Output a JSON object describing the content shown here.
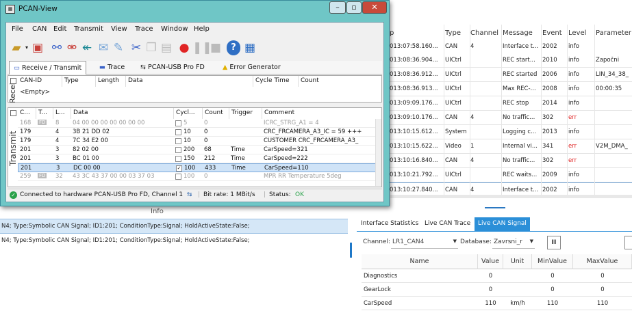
{
  "window": {
    "title": "PCAN-View"
  },
  "menu": [
    "File",
    "CAN",
    "Edit",
    "Transmit",
    "View",
    "Trace",
    "Window",
    "Help"
  ],
  "tabs": [
    "Receive / Transmit",
    "Trace",
    "PCAN-USB Pro FD",
    "Error Generator"
  ],
  "receive": {
    "side_label": "Recei",
    "columns": [
      "CAN-ID",
      "Type",
      "Length",
      "Data",
      "Cycle Time",
      "Count"
    ],
    "empty_text": "<Empty>"
  },
  "transmit": {
    "side_label": "Transmit",
    "columns": [
      "C...",
      "T...",
      "L...",
      "Data",
      "Cycl...",
      "Count",
      "Trigger",
      "Comment"
    ],
    "rows": [
      {
        "id": "168",
        "type": "FD",
        "len": "8",
        "data": "04 00 00 00 00 00 00 00",
        "cycle": "5",
        "count": "0",
        "trigger": "",
        "comment": "ICRC_STRG_A1 = 4",
        "checked": false,
        "dim": true
      },
      {
        "id": "179",
        "type": "",
        "len": "4",
        "data": "3B 21 DD 02",
        "cycle": "10",
        "count": "0",
        "trigger": "",
        "comment": "CRC_FRCAMERA_A3_IC = 59 +++",
        "checked": false,
        "dim": false
      },
      {
        "id": "179",
        "type": "",
        "len": "4",
        "data": "7C 34 E2 00",
        "cycle": "10",
        "count": "0",
        "trigger": "",
        "comment": "CUSTOMER CRC_FRCAMERA_A3_",
        "checked": false,
        "dim": false
      },
      {
        "id": "201",
        "type": "",
        "len": "3",
        "data": "82 02 00",
        "cycle": "200",
        "count": "68",
        "trigger": "Time",
        "comment": "CarSpeed=321",
        "checked": false,
        "dim": false
      },
      {
        "id": "201",
        "type": "",
        "len": "3",
        "data": "BC 01 00",
        "cycle": "150",
        "count": "212",
        "trigger": "Time",
        "comment": "CarSpeed=222",
        "checked": false,
        "dim": false
      },
      {
        "id": "201",
        "type": "",
        "len": "3",
        "data": "DC 00 00",
        "cycle": "100",
        "count": "433",
        "trigger": "Time",
        "comment": "CarSpeed=110",
        "checked": true,
        "dim": false
      },
      {
        "id": "259",
        "type": "FD",
        "len": "32",
        "data": "43 3C 43 37 00 00 03 37 03",
        "cycle": "100",
        "count": "0",
        "trigger": "",
        "comment": "MPR RR Temperature 5deg",
        "checked": false,
        "dim": true
      }
    ]
  },
  "statusbar": {
    "connection": "Connected to hardware PCAN-USB Pro FD, Channel 1",
    "bitrate": "Bit rate: 1 MBit/s",
    "status": "Status:",
    "status_value": "OK"
  },
  "log": {
    "columns": [
      "p",
      "Type",
      "Channel",
      "Message",
      "Event",
      "Level",
      "Parameter"
    ],
    "rows": [
      {
        "time": "13:07:58.160...",
        "type": "CAN",
        "channel": "4",
        "message": "Interface t...",
        "event": "2002",
        "level": "info",
        "param": ""
      },
      {
        "time": "13:08:36.904...",
        "type": "UICtrl",
        "channel": "",
        "message": "REC start...",
        "event": "2010",
        "level": "info",
        "param": "Započni"
      },
      {
        "time": "13:08:36.912...",
        "type": "UICtrl",
        "channel": "",
        "message": "REC started",
        "event": "2006",
        "level": "info",
        "param": "LIN_34_38_"
      },
      {
        "time": "13:08:36.913...",
        "type": "UICtrl",
        "channel": "",
        "message": "Max REC-...",
        "event": "2008",
        "level": "info",
        "param": "00:00:35"
      },
      {
        "time": "13:09:09.176...",
        "type": "UICtrl",
        "channel": "",
        "message": "REC stop",
        "event": "2014",
        "level": "info",
        "param": ""
      },
      {
        "time": "13:09:10.176...",
        "type": "CAN",
        "channel": "4",
        "message": "No traffic...",
        "event": "302",
        "level": "err",
        "param": ""
      },
      {
        "time": "13:10:15.612...",
        "type": "System",
        "channel": "",
        "message": "Logging c...",
        "event": "2013",
        "level": "info",
        "param": ""
      },
      {
        "time": "13:10:15.622...",
        "type": "Video",
        "channel": "1",
        "message": "Internal vi...",
        "event": "341",
        "level": "err",
        "param": "V2M_DMA_"
      },
      {
        "time": "13:10:16.840...",
        "type": "CAN",
        "channel": "4",
        "message": "No traffic...",
        "event": "302",
        "level": "err",
        "param": ""
      },
      {
        "time": "13:10:21.792...",
        "type": "UICtrl",
        "channel": "",
        "message": "REC waits...",
        "event": "2009",
        "level": "info",
        "param": ""
      },
      {
        "time": "13:10:27.840...",
        "type": "CAN",
        "channel": "4",
        "message": "Interface t...",
        "event": "2002",
        "level": "info",
        "param": ""
      }
    ],
    "row_prefix": "0"
  },
  "info": {
    "title": "Info",
    "conditions": [
      "N4; Type:Symbolic CAN Signal; ID1:201; ConditionType:Signal; HoldActiveState:False;",
      "N4; Type:Symbolic CAN Signal; ID1:201; ConditionType:Signal; HoldActiveState:False;"
    ]
  },
  "right_panel": {
    "tabs": [
      "Interface Statistics",
      "Live CAN Trace",
      "Live CAN Signal"
    ],
    "channel_label": "Channel:",
    "channel_value": "LR1_CAN4",
    "database_label": "Database:",
    "database_value": "Zavrsni_r",
    "pause_symbol": "II",
    "columns": [
      "Name",
      "Value",
      "Unit",
      "MinValue",
      "MaxValue"
    ],
    "signals": [
      {
        "name": "Diagnostics",
        "value": "0",
        "unit": "",
        "min": "0",
        "max": "0"
      },
      {
        "name": "GearLock",
        "value": "0",
        "unit": "",
        "min": "0",
        "max": "0"
      },
      {
        "name": "CarSpeed",
        "value": "110",
        "unit": "km/h",
        "min": "110",
        "max": "110"
      }
    ]
  },
  "colors": {
    "accent": "#2b8fd8",
    "window_frame": "#6fc6c6",
    "error_red": "#e02424",
    "ok_green": "#2aa24a"
  }
}
